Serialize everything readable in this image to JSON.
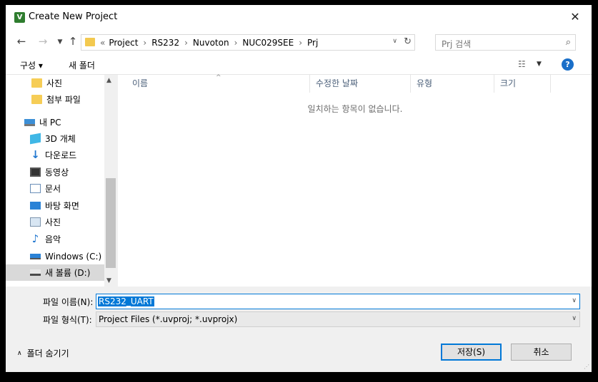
{
  "window": {
    "title": "Create New Project",
    "close": "✕"
  },
  "nav": {
    "back": "←",
    "forward": "→",
    "recent": "⌄",
    "up": "↑",
    "breadcrumb_overflow": "«",
    "breadcrumbs": [
      "Project",
      "RS232",
      "Nuvoton",
      "NUC029SEE",
      "Prj"
    ],
    "refresh": "↻",
    "search_placeholder": "Prj 검색"
  },
  "toolbar": {
    "organize": "구성 ▾",
    "new_folder": "새 폴더",
    "help": "?"
  },
  "sidebar": {
    "items": [
      {
        "label": "사진",
        "icon": "folder-icon"
      },
      {
        "label": "첨부 파일",
        "icon": "folder-icon"
      },
      {
        "label": "내 PC",
        "icon": "pc-icon"
      },
      {
        "label": "3D 개체",
        "icon": "3d-objects-icon"
      },
      {
        "label": "다운로드",
        "icon": "download-icon"
      },
      {
        "label": "동영상",
        "icon": "video-icon"
      },
      {
        "label": "문서",
        "icon": "document-icon"
      },
      {
        "label": "바탕 화면",
        "icon": "desktop-icon"
      },
      {
        "label": "사진",
        "icon": "pictures-icon"
      },
      {
        "label": "음악",
        "icon": "music-icon"
      },
      {
        "label": "Windows (C:)",
        "icon": "drive-c-icon"
      },
      {
        "label": "새 볼륨 (D:)",
        "icon": "drive-icon",
        "selected": true
      }
    ]
  },
  "filelist": {
    "columns": [
      "이름",
      "수정한 날짜",
      "유형",
      "크기"
    ],
    "empty_message": "일치하는 항목이 없습니다."
  },
  "form": {
    "filename_label": "파일 이름(N):",
    "filename_value": "RS232_UART",
    "filetype_label": "파일 형식(T):",
    "filetype_value": "Project Files (*.uvproj; *.uvprojx)"
  },
  "footer": {
    "hide_folders": "폴더 숨기기",
    "save": "저장(S)",
    "cancel": "취소"
  }
}
